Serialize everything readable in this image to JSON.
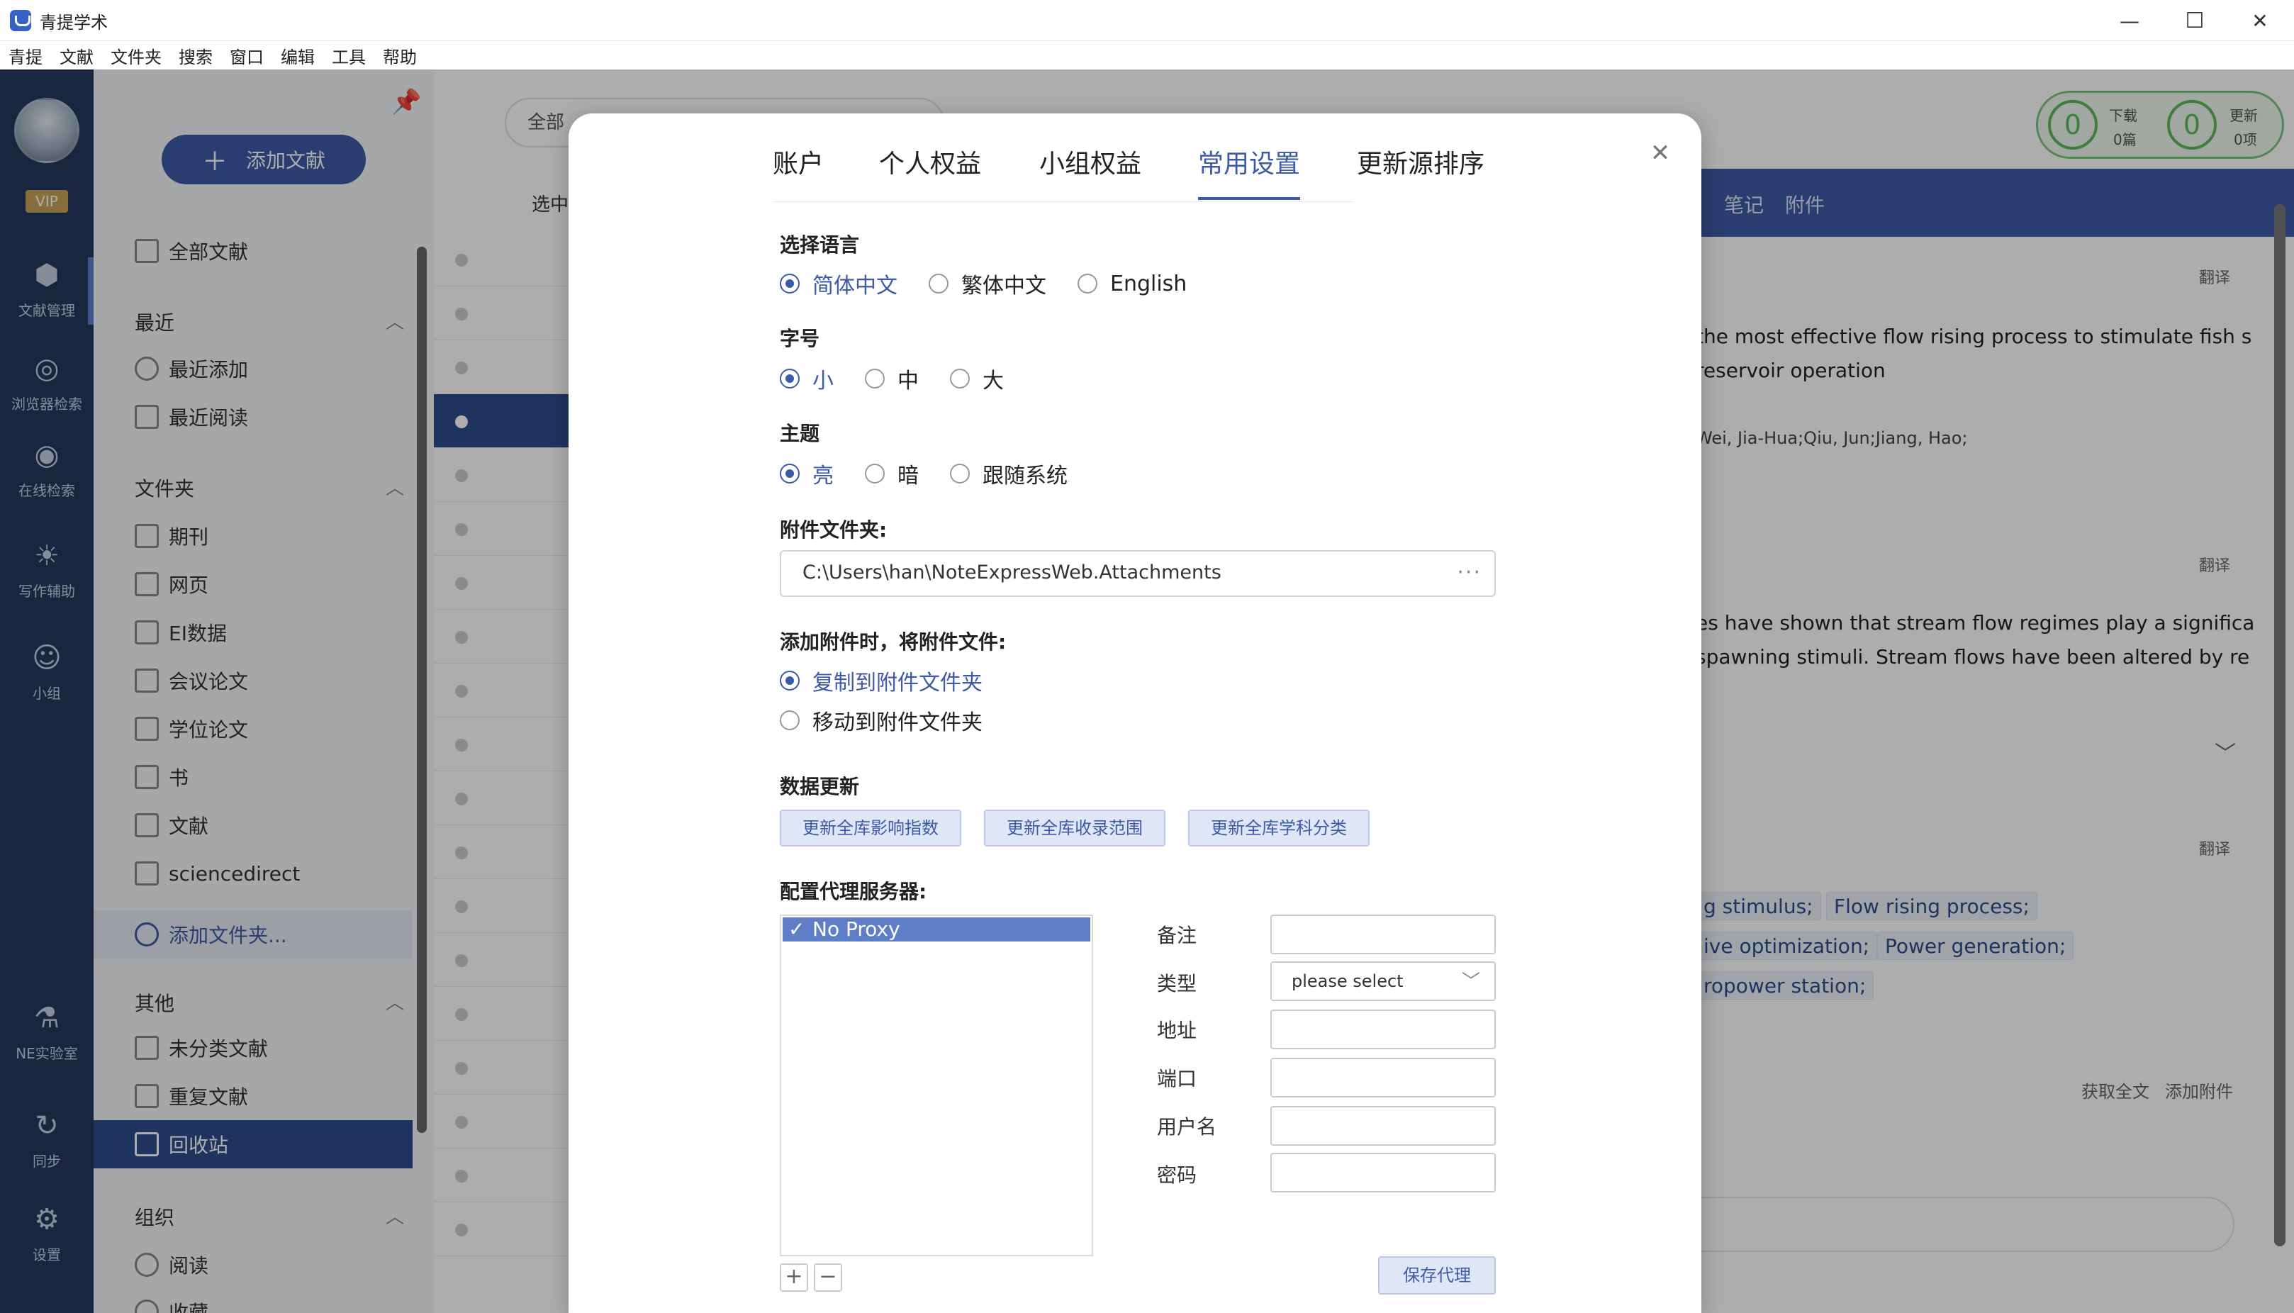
{
  "app": {
    "title": "青提学术",
    "window_controls": {
      "minimize": "—",
      "maximize": "☐",
      "close": "✕"
    }
  },
  "menubar": [
    "青提",
    "文献",
    "文件夹",
    "搜索",
    "窗口",
    "编辑",
    "工具",
    "帮助"
  ],
  "iconnav": {
    "vip": "VIP",
    "items": [
      {
        "label": "文献管理",
        "icon": "cube-icon"
      },
      {
        "label": "浏览器检索",
        "icon": "browser-icon"
      },
      {
        "label": "在线检索",
        "icon": "eye-icon"
      },
      {
        "label": "写作辅助",
        "icon": "lightbulb-icon"
      },
      {
        "label": "小组",
        "icon": "group-icon"
      },
      {
        "label": "NE实验室",
        "icon": "microscope-icon"
      },
      {
        "label": "同步",
        "icon": "sync-icon"
      },
      {
        "label": "设置",
        "icon": "gear-icon"
      }
    ]
  },
  "leftpanel": {
    "add_button": "添加文献",
    "all_docs": "全部文献",
    "recent": {
      "title": "最近",
      "items": [
        "最近添加",
        "最近阅读"
      ]
    },
    "folders": {
      "title": "文件夹",
      "items": [
        "期刊",
        "网页",
        "EI数据",
        "会议论文",
        "学位论文",
        "书",
        "文献",
        "sciencedirect"
      ],
      "add": "添加文件夹..."
    },
    "other": {
      "title": "其他",
      "items": [
        "未分类文献",
        "重复文献",
        "回收站"
      ]
    },
    "org": {
      "title": "组织",
      "items": [
        "阅读",
        "收藏"
      ]
    }
  },
  "midlist": {
    "search_scope": "全部",
    "selected_label": "选中"
  },
  "rightpane": {
    "download": {
      "count": "0",
      "label": "下载",
      "sub": "0篇"
    },
    "update": {
      "count": "0",
      "label": "更新",
      "sub": "0项"
    },
    "tabs": [
      "笔记",
      "附件"
    ],
    "translate": "翻译",
    "title_lines": [
      "the most effective flow rising process to stimulate fish s",
      "reservoir operation"
    ],
    "authors": "Wei, Jia-Hua;Qiu, Jun;Jiang, Hao;",
    "abstract_lines": [
      "es have shown that stream flow regimes play a significa",
      "spawning stimuli. Stream flows have been altered by re",
      "."
    ],
    "keywords": [
      "g stimulus;",
      "Flow rising process;",
      "ive optimization;",
      "Power generation;",
      "ropower station;"
    ],
    "actions": [
      "获取全文",
      "添加附件"
    ]
  },
  "modal": {
    "tabs": [
      "账户",
      "个人权益",
      "小组权益",
      "常用设置",
      "更新源排序"
    ],
    "active_tab": "常用设置",
    "language": {
      "label": "选择语言",
      "options": [
        "简体中文",
        "繁体中文",
        "English"
      ],
      "selected": "简体中文"
    },
    "fontsize": {
      "label": "字号",
      "options": [
        "小",
        "中",
        "大"
      ],
      "selected": "小"
    },
    "theme": {
      "label": "主题",
      "options": [
        "亮",
        "暗",
        "跟随系统"
      ],
      "selected": "亮"
    },
    "attach_folder": {
      "label": "附件文件夹:",
      "value": "C:\\Users\\han\\NoteExpressWeb.Attachments",
      "more": "···"
    },
    "attach_mode": {
      "label": "添加附件时，将附件文件:",
      "options": [
        "复制到附件文件夹",
        "移动到附件文件夹"
      ],
      "selected": "复制到附件文件夹"
    },
    "data_update": {
      "label": "数据更新",
      "buttons": [
        "更新全库影响指数",
        "更新全库收录范围",
        "更新全库学科分类"
      ]
    },
    "proxy": {
      "label": "配置代理服务器:",
      "list": [
        "No Proxy"
      ],
      "selected": "No Proxy",
      "add": "+",
      "remove": "−",
      "fields": {
        "note": "备注",
        "type": "类型",
        "type_placeholder": "please select",
        "address": "地址",
        "port": "端口",
        "username": "用户名",
        "password": "密码"
      },
      "save": "保存代理"
    }
  }
}
